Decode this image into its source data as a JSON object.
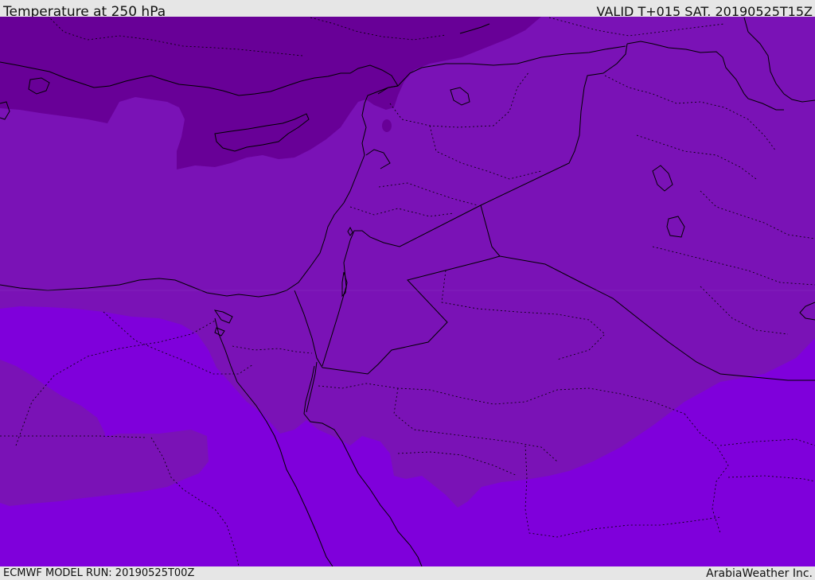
{
  "header": {
    "title": "Temperature at 250 hPa",
    "valid_time": "VALID T+015 SAT. 20190525T15Z"
  },
  "footer": {
    "model_run": "ECMWF MODEL RUN: 20190525T00Z",
    "credit": "ArabiaWeather Inc."
  },
  "map": {
    "colors": {
      "coldest_band": "#680097",
      "middle_band": "#7a12b6",
      "warm_band": "#7f00db",
      "border_line": "#000000"
    }
  }
}
